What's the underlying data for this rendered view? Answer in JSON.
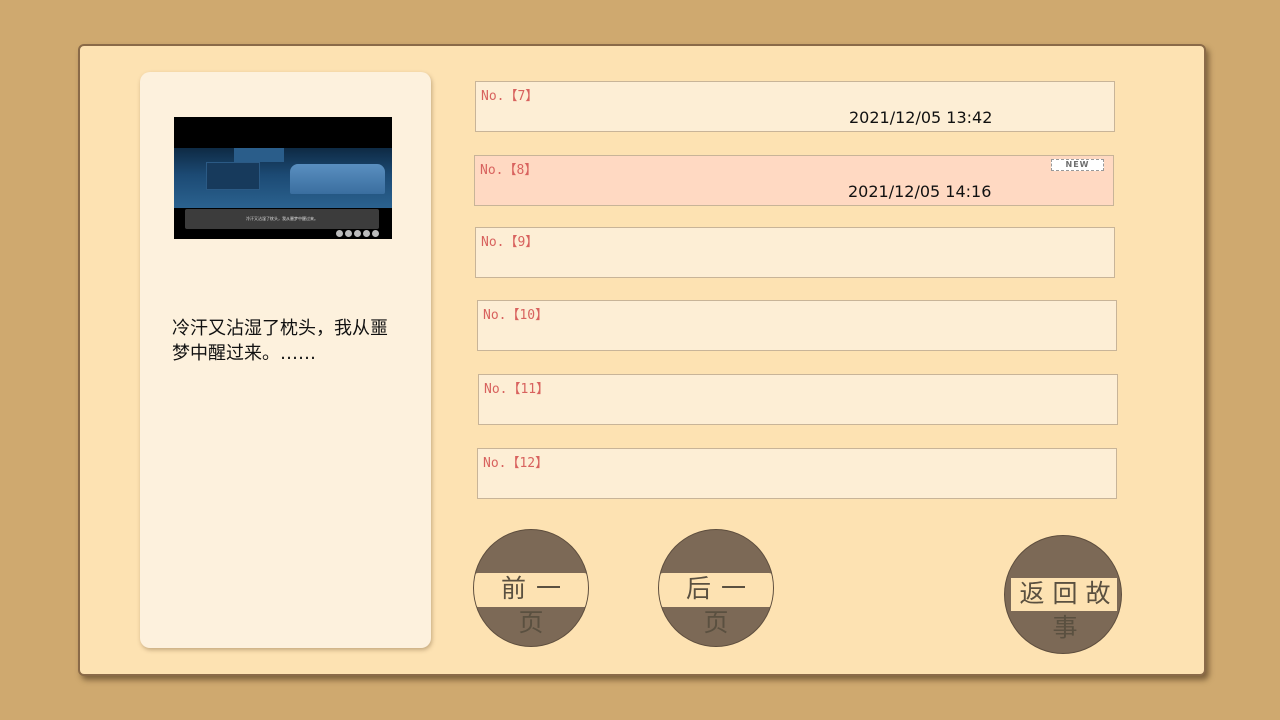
{
  "preview": {
    "thumbnail_caption": "冷汗又沾湿了枕头，我从噩梦中醒过来。",
    "text": "冷汗又沾湿了枕头，我从噩梦中醒过来。……"
  },
  "slots": [
    {
      "label": "No.【7】",
      "date": "2021/12/05 13:42",
      "new": ""
    },
    {
      "label": "No.【8】",
      "date": "2021/12/05 14:16",
      "new": "NEW"
    },
    {
      "label": "No.【9】",
      "date": "",
      "new": ""
    },
    {
      "label": "No.【10】",
      "date": "",
      "new": ""
    },
    {
      "label": "No.【11】",
      "date": "",
      "new": ""
    },
    {
      "label": "No.【12】",
      "date": "",
      "new": ""
    }
  ],
  "buttons": {
    "prev_page": "前一页",
    "next_page": "后一页",
    "return_story": "返回故事"
  },
  "colors": {
    "background": "#cfa96f",
    "panel": "#fde2b2",
    "slot": "#fdeed5",
    "slot_selected": "#ffd9c2",
    "slot_number": "#d8625e",
    "button": "#7c6956"
  }
}
